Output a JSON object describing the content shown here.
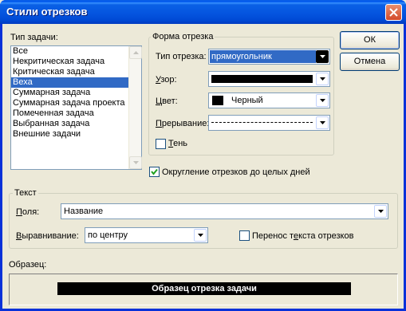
{
  "window": {
    "title": "Стили отрезков"
  },
  "task_type": {
    "label": "Тип задачи:",
    "items": [
      "Все",
      "Некритическая задача",
      "Критическая задача",
      "Веха",
      "Суммарная задача",
      "Суммарная задача проекта",
      "Помеченная задача",
      "Выбранная задача",
      "Внешние задачи"
    ],
    "selected_index": 3
  },
  "bar_shape": {
    "legend": "Форма отрезка",
    "type_label": "Тип отрезка:",
    "type_value": "прямоугольник",
    "pattern_label": "Узор:",
    "color_label": "Цвет:",
    "color_value": "Черный",
    "color_swatch": "#000000",
    "border_label": "Прерывание:",
    "shadow_label": "Тень",
    "shadow_checked": false
  },
  "rounding": {
    "label": "Округление отрезков до целых дней",
    "checked": true
  },
  "text_group": {
    "legend": "Текст",
    "fields_label": "Поля:",
    "fields_value": "Название",
    "align_label": "Выравнивание:",
    "align_value": "по центру",
    "wrap_label": "Перенос текста отрезков",
    "wrap_checked": false
  },
  "buttons": {
    "ok": "ОК",
    "cancel": "Отмена"
  },
  "sample": {
    "label": "Образец:",
    "bar_text": "Образец отрезка задачи"
  },
  "colors": {
    "title_bar": "#0453de",
    "selection": "#316ac5",
    "dialog_bg": "#ece9d8"
  }
}
